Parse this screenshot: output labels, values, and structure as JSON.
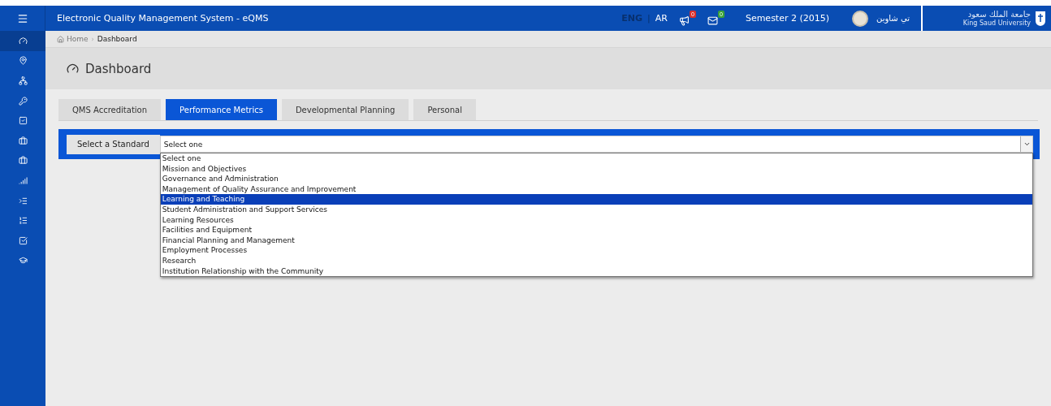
{
  "header": {
    "title": "Electronic Quality Management System - eQMS",
    "languages": [
      {
        "label": "ENG",
        "selected": true
      },
      {
        "label": "AR",
        "selected": false
      }
    ],
    "notifications": {
      "count": "0"
    },
    "messages": {
      "count": "0"
    },
    "semester": "Semester 2 (2015)",
    "user_name": "تي شاوين",
    "logo": {
      "arabic": "جامعة الملك سعود",
      "english": "King Saud University"
    }
  },
  "sidebar": {
    "items": [
      {
        "selected": true
      },
      {
        "selected": false
      },
      {
        "selected": false
      },
      {
        "selected": false
      },
      {
        "selected": false
      },
      {
        "selected": false
      },
      {
        "selected": false
      },
      {
        "selected": false
      },
      {
        "selected": false
      },
      {
        "selected": false
      },
      {
        "selected": false
      },
      {
        "selected": false
      }
    ]
  },
  "breadcrumb": [
    {
      "label": "Home"
    },
    {
      "label": "Dashboard"
    }
  ],
  "breadcrumb_separator": "›",
  "language_separator": "|",
  "page_title": "Dashboard",
  "tabs": [
    {
      "label": "QMS Accreditation",
      "selected": false
    },
    {
      "label": "Performance Metrics",
      "selected": true
    },
    {
      "label": "Developmental Planning",
      "selected": false
    },
    {
      "label": "Personal",
      "selected": false
    }
  ],
  "standard_select": {
    "label": "Select a Standard",
    "value": "Select one",
    "options": [
      {
        "label": "Select one",
        "highlighted": false
      },
      {
        "label": "Mission and Objectives",
        "highlighted": false
      },
      {
        "label": "Governance and Administration",
        "highlighted": false
      },
      {
        "label": "Management of Quality Assurance and Improvement",
        "highlighted": false
      },
      {
        "label": "Learning and Teaching",
        "highlighted": true
      },
      {
        "label": "Student Administration and Support Services",
        "highlighted": false
      },
      {
        "label": "Learning Resources",
        "highlighted": false
      },
      {
        "label": "Facilities and Equipment",
        "highlighted": false
      },
      {
        "label": "Financial Planning and Management",
        "highlighted": false
      },
      {
        "label": "Employment Processes",
        "highlighted": false
      },
      {
        "label": "Research",
        "highlighted": false
      },
      {
        "label": "Institution Relationship with the Community",
        "highlighted": false
      }
    ]
  }
}
